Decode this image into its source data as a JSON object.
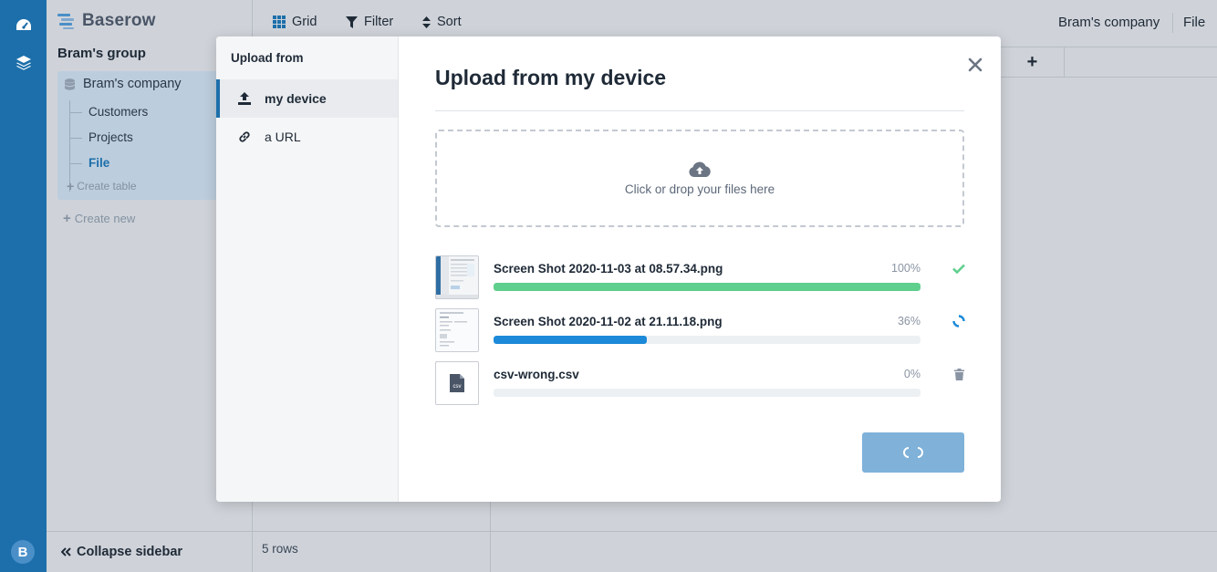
{
  "app": {
    "name": "Baserow"
  },
  "rail": {
    "avatar_letter": "B"
  },
  "sidebar": {
    "group_title": "Bram's group",
    "database": "Bram's company",
    "tables": [
      "Customers",
      "Projects",
      "File"
    ],
    "active_table": "File",
    "create_table": "Create table",
    "create_new": "Create new",
    "collapse": "Collapse sidebar"
  },
  "toolbar": {
    "grid": "Grid",
    "filter": "Filter",
    "sort": "Sort",
    "breadcrumb_database": "Bram's company",
    "breadcrumb_table": "File"
  },
  "footer": {
    "rows": "5 rows"
  },
  "modal": {
    "side_title": "Upload from",
    "options": [
      {
        "label": "my device",
        "icon": "upload-icon",
        "active": true
      },
      {
        "label": "a URL",
        "icon": "link-icon",
        "active": false
      }
    ],
    "title": "Upload from my device",
    "dropzone_text": "Click or drop your files here",
    "files": [
      {
        "name": "Screen Shot 2020-11-03 at 08.57.34.png",
        "percent": "100%",
        "progress": 1.0,
        "status": "done",
        "bar_color": "#5fcf8d"
      },
      {
        "name": "Screen Shot 2020-11-02 at 21.11.18.png",
        "percent": "36%",
        "progress": 0.36,
        "status": "uploading",
        "bar_color": "#1c8ad8"
      },
      {
        "name": "csv-wrong.csv",
        "percent": "0%",
        "progress": 0.0,
        "status": "pending",
        "bar_color": "#1c8ad8",
        "thumb_label": "csv"
      }
    ],
    "upload_button_state": "loading"
  },
  "colors": {
    "rail": "#1c6faa",
    "accent": "#1c6faa",
    "success": "#5fcf8d",
    "button_disabled": "#7fb1d9"
  }
}
